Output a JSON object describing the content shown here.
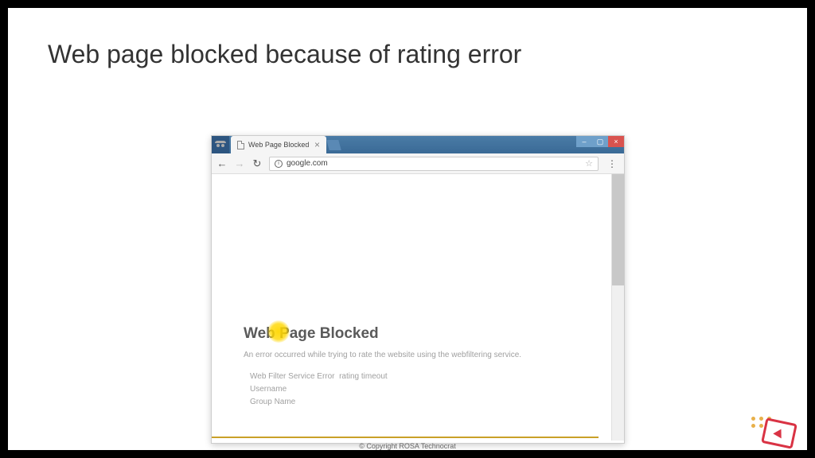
{
  "slide": {
    "title": "Web page blocked because of rating error",
    "copyright": "© Copyright ROSA Technocrat"
  },
  "browser": {
    "tab_title": "Web Page Blocked",
    "url": "google.com"
  },
  "blocked": {
    "heading": "Web Page Blocked",
    "description": "An error occurred while trying to rate the website using the webfiltering service.",
    "field1_label": "Web Filter Service Error",
    "field1_value": "rating timeout",
    "field2": "Username",
    "field3": "Group Name"
  }
}
